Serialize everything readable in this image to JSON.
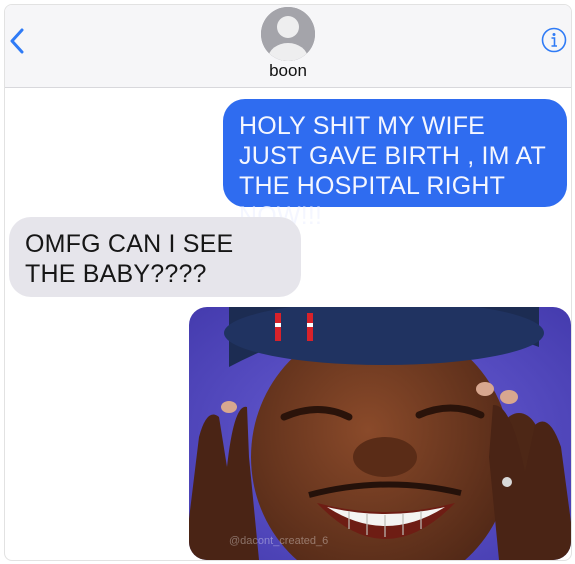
{
  "header": {
    "back_icon": "chevron-left-icon",
    "contact_name": "boon",
    "info_icon": "info-icon"
  },
  "messages": [
    {
      "direction": "sent",
      "text": "HOLY SHIT MY WIFE JUST GAVE BIRTH , IM AT THE HOSPITAL RIGHT NOW!!!"
    },
    {
      "direction": "received",
      "text": "OMFG CAN I SEE THE BABY????"
    }
  ],
  "image_message": {
    "watermark": "@dacont_created_6"
  },
  "colors": {
    "sent_bubble": "#2f6cf0",
    "received_bubble": "#e6e5eb",
    "accent": "#2f7bf6"
  }
}
